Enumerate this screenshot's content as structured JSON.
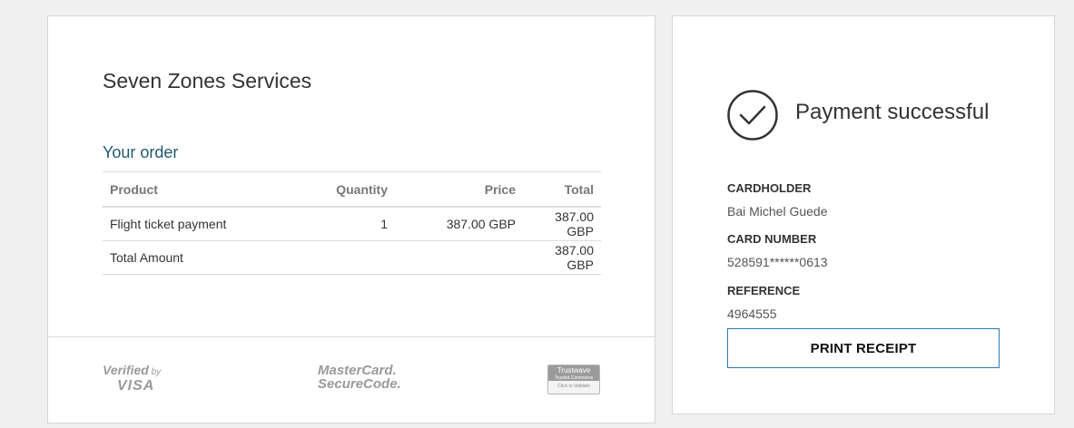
{
  "order": {
    "merchant_name": "Seven Zones Services",
    "heading": "Your order",
    "columns": {
      "product": "Product",
      "quantity": "Quantity",
      "price": "Price",
      "total": "Total"
    },
    "items": [
      {
        "product": "Flight ticket payment",
        "quantity": "1",
        "price": "387.00 GBP",
        "total": "387.00 GBP"
      }
    ],
    "total_row": {
      "label": "Total Amount",
      "value": "387.00 GBP"
    }
  },
  "badges": {
    "visa": {
      "line1": "Verified",
      "line1_small": "by",
      "line2": "VISA"
    },
    "mastercard": {
      "line1": "MasterCard.",
      "line2": "SecureCode."
    },
    "trustwave": {
      "line1": "Trustwave",
      "line2": "Trusted Commerce",
      "line3": "Click to Validate"
    }
  },
  "payment": {
    "status_text": "Payment successful",
    "status_icon": "check-circle-icon",
    "cardholder_label": "CARDHOLDER",
    "cardholder_value": "Bai Michel Guede",
    "card_number_label": "CARD NUMBER",
    "card_number_value": "528591******0613",
    "reference_label": "REFERENCE",
    "reference_value": "4964555",
    "print_button": "PRINT RECEIPT"
  },
  "colors": {
    "accent_heading": "#1f5a6b",
    "button_border": "#2a7ab0",
    "background": "#f0f0f0"
  }
}
